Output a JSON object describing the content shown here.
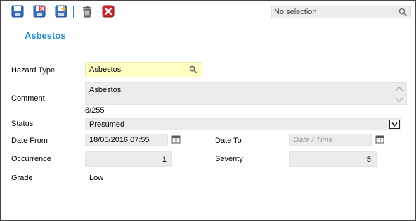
{
  "toolbar": {
    "icons": [
      "save-icon",
      "save-close-icon",
      "save-new-icon",
      "delete-icon",
      "close-icon"
    ],
    "search_placeholder": "No selection"
  },
  "form": {
    "title": "Asbestos",
    "hazard_type": {
      "label": "Hazard Type",
      "value": "Asbestos"
    },
    "comment": {
      "label": "Comment",
      "value": "Asbestos",
      "counter": "8/255"
    },
    "status": {
      "label": "Status",
      "value": "Presumed"
    },
    "date_from": {
      "label": "Date From",
      "value": "18/05/2016 07:55"
    },
    "date_to": {
      "label": "Date To",
      "placeholder": "Date / Time",
      "value": ""
    },
    "occurrence": {
      "label": "Occurrence",
      "value": "1"
    },
    "severity": {
      "label": "Severity",
      "value": "5"
    },
    "grade": {
      "label": "Grade",
      "value": "Low"
    }
  },
  "colors": {
    "accent": "#2b8fcf",
    "hazard_field_bg": "#ffffc4",
    "field_bg": "#ececec",
    "close_red": "#c8282a"
  }
}
